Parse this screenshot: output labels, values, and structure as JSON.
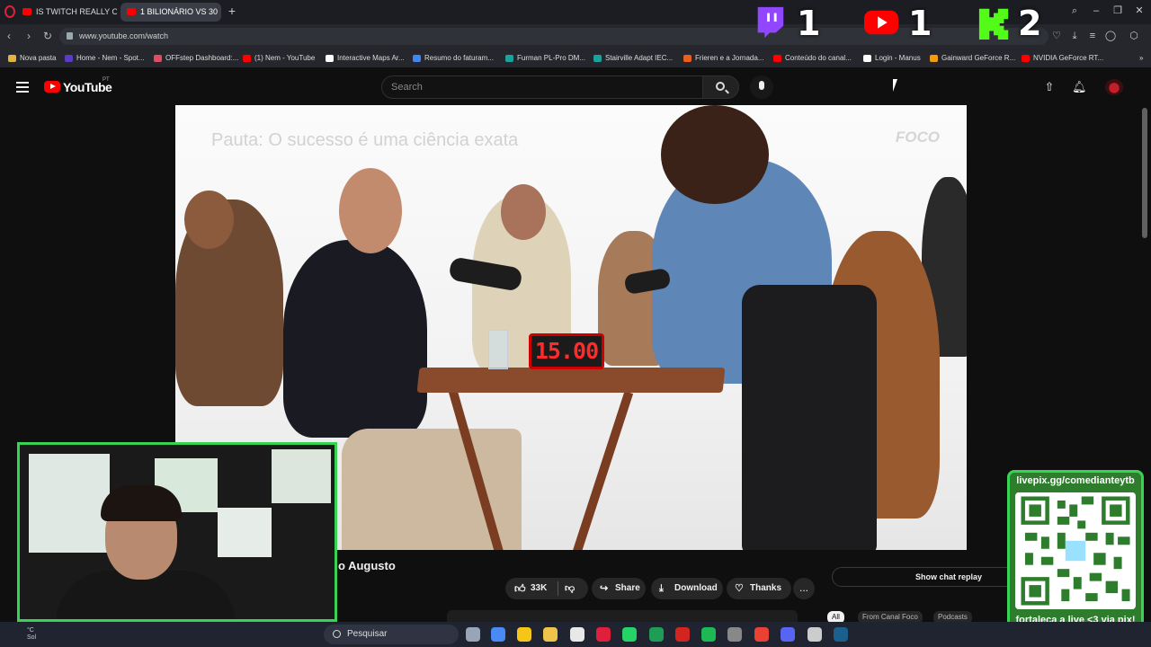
{
  "browser": {
    "tabs": [
      {
        "label": "IS TWITCH REALLY OVER",
        "active": false
      },
      {
        "label": "1 BILIONÁRIO VS 30",
        "active": true
      }
    ],
    "url": "www.youtube.com/watch",
    "bookmarks": [
      {
        "label": "Nova pasta",
        "color": "#e3b341"
      },
      {
        "label": "Home - Nem - Spot...",
        "color": "#5b3cc4"
      },
      {
        "label": "OFFstep Dashboard:...",
        "color": "#e34b62"
      },
      {
        "label": "(1) Nem - YouTube",
        "color": "#ff0000"
      },
      {
        "label": "Interactive Maps Ar...",
        "color": "#ffffff"
      },
      {
        "label": "Resumo do faturam...",
        "color": "#4285f4"
      },
      {
        "label": "Furman PL-Pro DM...",
        "color": "#1aa39a"
      },
      {
        "label": "Stairville Adapt IEC...",
        "color": "#1aa39a"
      },
      {
        "label": "Frieren e a Jornada...",
        "color": "#e8601c"
      },
      {
        "label": "Conteúdo do canal...",
        "color": "#ff0000"
      },
      {
        "label": "Login - Manus",
        "color": "#ffffff"
      },
      {
        "label": "Gainward GeForce R...",
        "color": "#f39c12"
      },
      {
        "label": "NVIDIA GeForce RT...",
        "color": "#ff0000"
      }
    ]
  },
  "scoreboard": {
    "twitch": {
      "icon": "twitch-icon",
      "score": "1",
      "color": "#9146ff"
    },
    "youtube": {
      "icon": "youtube-icon",
      "score": "1",
      "color": "#ff0000"
    },
    "kick": {
      "icon": "kick-icon",
      "score": "2",
      "color": "#53fc18"
    }
  },
  "youtube": {
    "wordmark": "YouTube",
    "country": "PT",
    "search_placeholder": "Search",
    "video": {
      "caption": "Pauta: O sucesso é uma ciência exata",
      "watermark": "FOCO",
      "timer": "15.00"
    },
    "title_fragment": "o Augusto",
    "actions": {
      "likes": "33K",
      "share": "Share",
      "download": "Download",
      "thanks": "Thanks",
      "more": "..."
    },
    "chat_replay": "Show chat replay",
    "chips": [
      "All",
      "From Canal Foco",
      "Podcasts"
    ]
  },
  "stream_overlay": {
    "qr_top": "livepix.gg/comedianteytb",
    "qr_bottom": "fortaleça a live <3 via pix!"
  },
  "taskbar": {
    "search_placeholder": "Pesquisar",
    "weather_temp": "°C",
    "weather_desc": "Sol",
    "apps": [
      "task-view-icon",
      "chrome-icon",
      "stats-icon",
      "file-explorer-icon",
      "capcut-icon",
      "opera-icon",
      "whatsapp-icon",
      "browser-icon",
      "acrobat-icon",
      "spotify-icon",
      "obs-icon",
      "chrome-icon-2",
      "discord-icon",
      "app-icon",
      "steam-icon"
    ]
  }
}
